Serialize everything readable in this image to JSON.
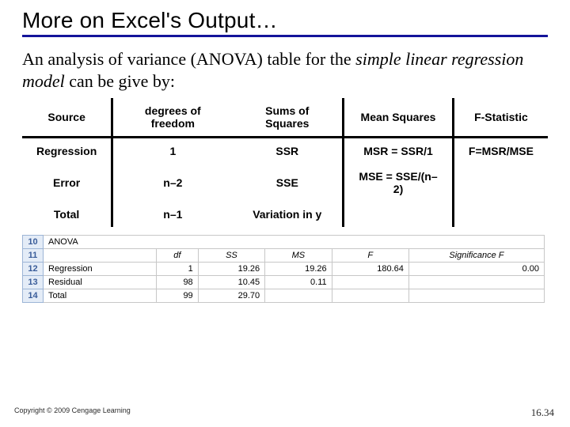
{
  "title": "More on Excel's Output…",
  "desc_pre": "An analysis of variance (ANOVA) table for the ",
  "desc_ital": "simple linear regression model",
  "desc_post": " can be give by:",
  "anova": {
    "head": {
      "source": "Source",
      "df": "degrees of freedom",
      "ss": "Sums of Squares",
      "ms": "Mean Squares",
      "f": "F-Statistic"
    },
    "rows": [
      {
        "source": "Regression",
        "df": "1",
        "ss": "SSR",
        "ms": "MSR = SSR/1",
        "f": "F=MSR/MSE"
      },
      {
        "source": "Error",
        "df": "n–2",
        "ss": "SSE",
        "ms": "MSE = SSE/(n–2)",
        "f": ""
      },
      {
        "source": "Total",
        "df": "n–1",
        "ss": "Variation in y",
        "ms": "",
        "f": ""
      }
    ]
  },
  "excel": {
    "label_anova": "ANOVA",
    "head": {
      "df": "df",
      "ss": "SS",
      "ms": "MS",
      "f": "F",
      "sigf": "Significance F"
    },
    "rownums": [
      "10",
      "11",
      "12",
      "13",
      "14"
    ],
    "rows": [
      {
        "label": "Regression",
        "df": "1",
        "ss": "19.26",
        "ms": "19.26",
        "f": "180.64",
        "sigf": "0.00"
      },
      {
        "label": "Residual",
        "df": "98",
        "ss": "10.45",
        "ms": "0.11",
        "f": "",
        "sigf": ""
      },
      {
        "label": "Total",
        "df": "99",
        "ss": "29.70",
        "ms": "",
        "f": "",
        "sigf": ""
      }
    ]
  },
  "footer": {
    "copyright": "Copyright © 2009 Cengage Learning",
    "page": "16.34"
  },
  "chart_data": {
    "type": "table",
    "title": "ANOVA table for simple linear regression",
    "symbolic_table": {
      "columns": [
        "Source",
        "degrees of freedom",
        "Sums of Squares",
        "Mean Squares",
        "F-Statistic"
      ],
      "rows": [
        [
          "Regression",
          "1",
          "SSR",
          "MSR = SSR/1",
          "F=MSR/MSE"
        ],
        [
          "Error",
          "n–2",
          "SSE",
          "MSE = SSE/(n–2)",
          ""
        ],
        [
          "Total",
          "n–1",
          "Variation in y",
          "",
          ""
        ]
      ]
    },
    "excel_table": {
      "columns": [
        "",
        "df",
        "SS",
        "MS",
        "F",
        "Significance F"
      ],
      "rows": [
        [
          "Regression",
          1,
          19.26,
          19.26,
          180.64,
          0.0
        ],
        [
          "Residual",
          98,
          10.45,
          0.11,
          null,
          null
        ],
        [
          "Total",
          99,
          29.7,
          null,
          null,
          null
        ]
      ]
    }
  }
}
